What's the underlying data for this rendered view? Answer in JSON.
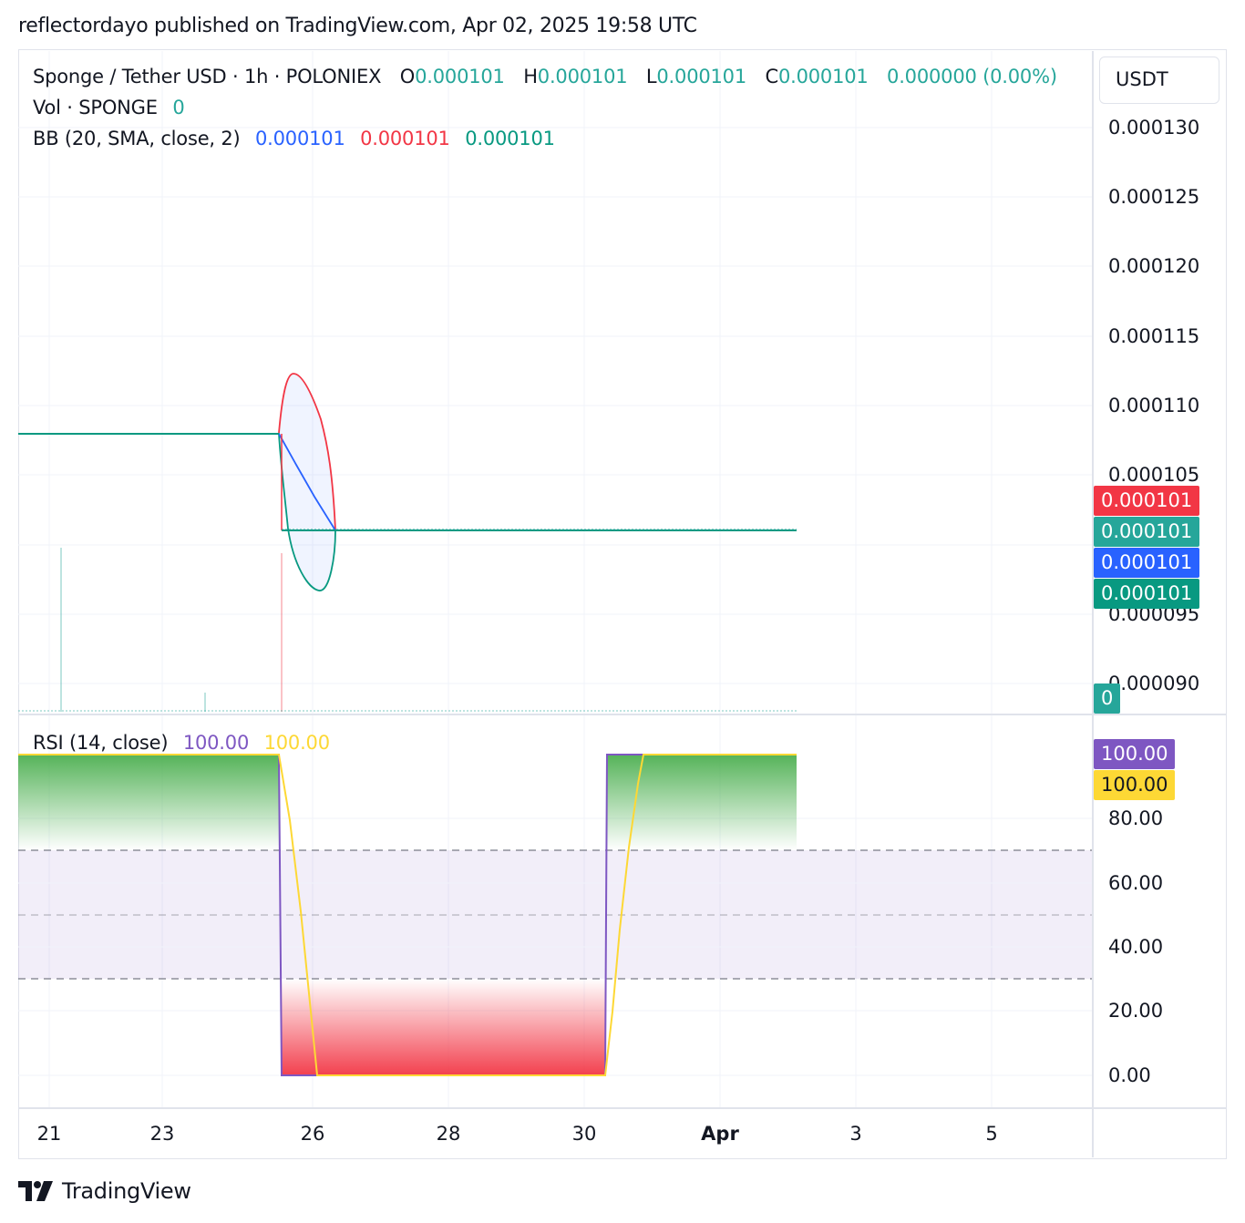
{
  "header": {
    "published_line": "reflectordayo published on TradingView.com, Apr 02, 2025 19:58 UTC"
  },
  "price_pane": {
    "symbol_line": "Sponge / Tether USD · 1h · POLONIEX",
    "ohlc": {
      "o_label": "O",
      "o": "0.000101",
      "h_label": "H",
      "h": "0.000101",
      "l_label": "L",
      "l": "0.000101",
      "c_label": "C",
      "c": "0.000101",
      "change": "0.000000 (0.00%)"
    },
    "volume": {
      "label": "Vol · SPONGE",
      "value": "0"
    },
    "bb": {
      "label": "BB (20, SMA, close, 2)",
      "basis": "0.000101",
      "upper": "0.000101",
      "lower": "0.000101"
    },
    "currency": "USDT",
    "y_ticks": [
      "0.000130",
      "0.000125",
      "0.000120",
      "0.000115",
      "0.000110",
      "0.000105",
      "0.000095",
      "0.000090"
    ],
    "price_tags": [
      {
        "value": "0.000101",
        "color": "#f23645"
      },
      {
        "value": "0.000101",
        "color": "#26a69a"
      },
      {
        "value": "0.000101",
        "color": "#2962ff"
      },
      {
        "value": "0.000101",
        "color": "#089981"
      }
    ],
    "volume_tag": {
      "value": "0",
      "color": "#26a69a"
    }
  },
  "rsi_pane": {
    "label": "RSI (14, close)",
    "rsi_value": "100.00",
    "ma_value": "100.00",
    "y_ticks": [
      "80.00",
      "60.00",
      "40.00",
      "20.00",
      "0.00"
    ],
    "tags": [
      {
        "value": "100.00",
        "color": "#7e57c2",
        "text_color": "#ffffff"
      },
      {
        "value": "100.00",
        "color": "#fdd835",
        "text_color": "#131722"
      }
    ]
  },
  "x_axis": {
    "ticks": [
      "21",
      "23",
      "26",
      "28",
      "30",
      "Apr",
      "3",
      "5"
    ]
  },
  "footer": {
    "brand": "TradingView"
  },
  "colors": {
    "up": "#26a69a",
    "down": "#f23645",
    "basis": "#2962ff",
    "bb_lower": "#089981",
    "rsi": "#7e57c2",
    "rsi_ma": "#fdd835",
    "band": "#7e57c2"
  },
  "chart_data": [
    {
      "type": "line",
      "title": "Sponge / Tether USD · 1h · POLONIEX",
      "ylabel": "USDT",
      "x": [
        "Mar 20",
        "Mar 23",
        "Mar 25",
        "Mar 25",
        "Mar 26",
        "Mar 31",
        "Apr 2"
      ],
      "ylim": [
        8.8e-05,
        0.000132
      ],
      "series": [
        {
          "name": "price",
          "values": [
            0.000108,
            0.000108,
            0.000108,
            0.000101,
            0.000101,
            0.000101,
            0.000101
          ]
        },
        {
          "name": "BB basis",
          "values": [
            0.000108,
            0.000108,
            0.000108,
            0.0001045,
            0.000101,
            0.000101,
            0.000101
          ]
        },
        {
          "name": "BB upper",
          "values": [
            0.000108,
            0.000108,
            0.000108,
            0.0001123,
            0.000101,
            0.000101,
            0.000101
          ]
        },
        {
          "name": "BB lower",
          "values": [
            0.000108,
            0.000108,
            0.000108,
            9.67e-05,
            0.000101,
            0.000101,
            0.000101
          ]
        }
      ]
    },
    {
      "type": "line",
      "title": "RSI (14, close)",
      "ylim": [
        0,
        100
      ],
      "bands": [
        30,
        50,
        70
      ],
      "series": [
        {
          "name": "RSI",
          "values": [
            100,
            100,
            100,
            0,
            0,
            0,
            100,
            100
          ]
        },
        {
          "name": "RSI MA",
          "values": [
            100,
            100,
            100,
            50,
            0,
            0,
            50,
            100
          ]
        }
      ]
    }
  ]
}
